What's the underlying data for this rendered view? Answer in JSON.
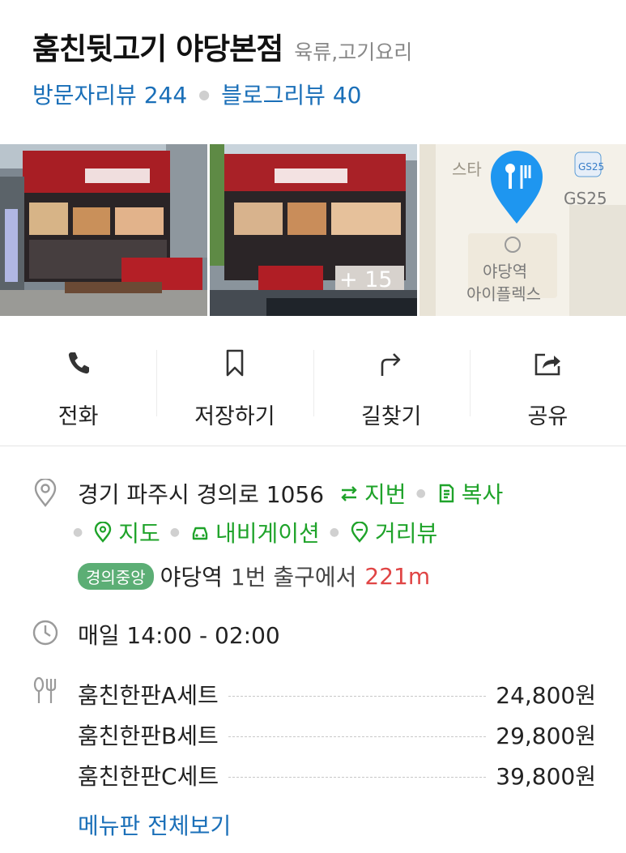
{
  "place": {
    "name": "훔친뒷고기 야당본점",
    "category": "육류,고기요리",
    "visitor_review": "방문자리뷰 244",
    "blog_review": "블로그리뷰 40"
  },
  "photos": {
    "more_count": "+ 15",
    "map_labels": {
      "store": "GS25",
      "building_line1": "야당역",
      "building_line2": "아이플렉스",
      "partial": "스타"
    }
  },
  "actions": [
    {
      "label": "전화",
      "icon": "phone-icon"
    },
    {
      "label": "저장하기",
      "icon": "bookmark-icon"
    },
    {
      "label": "길찾기",
      "icon": "directions-icon"
    },
    {
      "label": "공유",
      "icon": "share-icon"
    }
  ],
  "address": {
    "text": "경기 파주시 경의로 1056",
    "lot_number": "지번",
    "copy": "복사",
    "map": "지도",
    "navigation": "내비게이션",
    "street_view": "거리뷰"
  },
  "transit": {
    "line": "경의중앙",
    "station": "야당역",
    "exit_text": "1번 출구에서",
    "distance": "221m",
    "line_color": "#5cae75"
  },
  "hours": {
    "text": "매일 14:00 - 02:00"
  },
  "menu": {
    "items": [
      {
        "name": "훔친한판A세트",
        "price": "24,800원"
      },
      {
        "name": "훔친한판B세트",
        "price": "29,800원"
      },
      {
        "name": "훔친한판C세트",
        "price": "39,800원"
      }
    ],
    "more_label": "메뉴판 전체보기"
  },
  "colors": {
    "link_blue": "#1a6fb8",
    "action_green": "#1fa32a",
    "distance_red": "#e04545",
    "map_pin": "#1e96f0"
  }
}
